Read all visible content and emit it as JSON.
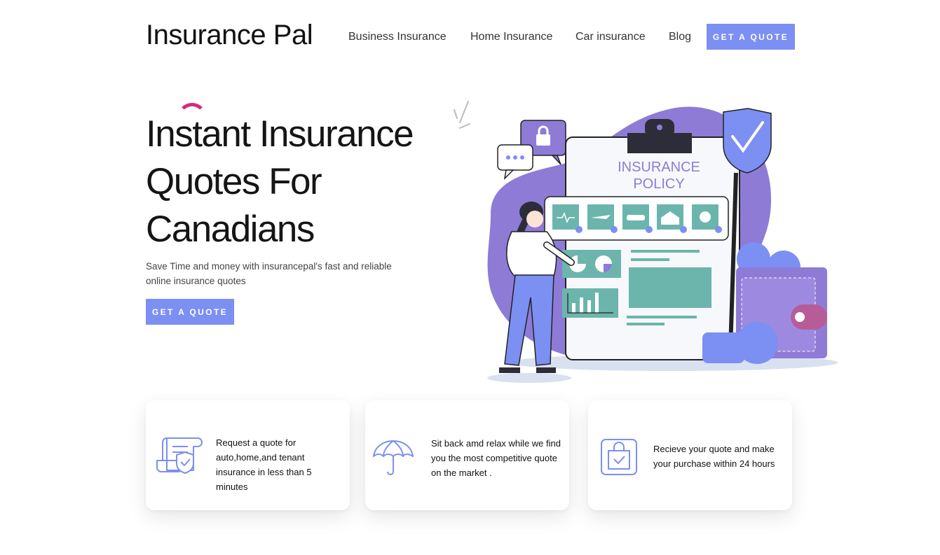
{
  "header": {
    "logo": "Insurance Pal",
    "nav": [
      {
        "label": "Business Insurance"
      },
      {
        "label": "Home Insurance"
      },
      {
        "label": "Car insurance"
      },
      {
        "label": "Blog"
      }
    ],
    "cta_label": "GET A QUOTE"
  },
  "hero": {
    "title_lines": [
      "Instant Insurance",
      "Quotes For",
      "Canadians"
    ],
    "subtitle": "Save Time and money with insurancepal's fast and reliable online insurance quotes",
    "cta_label": "GET A QUOTE",
    "illustration": {
      "title_line1": "INSURANCE",
      "title_line2": "POLICY"
    }
  },
  "features": [
    {
      "icon": "policy-document-shield-icon",
      "text": "Request a quote for auto,home,and tenant insurance in less than 5 minutes"
    },
    {
      "icon": "umbrella-icon",
      "text": "Sit back amd relax while we find you the  most competitive quote on the market ."
    },
    {
      "icon": "shopping-bag-check-icon",
      "text": "Recieve your quote and make your purchase within 24 hours"
    }
  ],
  "colors": {
    "accent": "#7c8ff2",
    "highlight_arc": "#d62b7b",
    "illustration_purple": "#8e7bd6",
    "illustration_teal": "#6bb5ad"
  }
}
